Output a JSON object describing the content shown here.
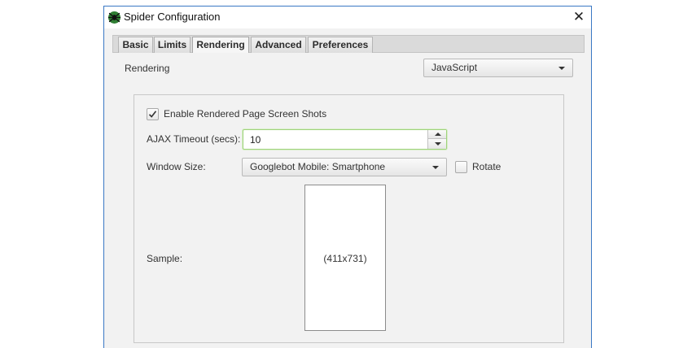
{
  "window": {
    "title": "Spider Configuration",
    "close_glyph": "✕"
  },
  "tabs": [
    {
      "label": "Basic"
    },
    {
      "label": "Limits"
    },
    {
      "label": "Rendering",
      "active": true
    },
    {
      "label": "Advanced"
    },
    {
      "label": "Preferences"
    }
  ],
  "rendering": {
    "label": "Rendering",
    "selected": "JavaScript"
  },
  "screenshots": {
    "checkbox_label": "Enable Rendered Page Screen Shots",
    "checked": true,
    "ajax_timeout_label": "AJAX Timeout (secs):",
    "ajax_timeout_value": "10",
    "window_size_label": "Window Size:",
    "window_size_selected": "Googlebot Mobile: Smartphone",
    "rotate_label": "Rotate",
    "rotate_checked": false,
    "sample_label": "Sample:",
    "sample_dimensions": "(411x731)"
  },
  "icons": {
    "app": "spider-icon",
    "close": "close-icon",
    "check": "checkmark-icon",
    "dropdown": "chevron-down-icon"
  },
  "colors": {
    "window_border": "#3a78c4",
    "focus_border": "#9fd27c",
    "app_icon_green": "#2e7d32"
  }
}
